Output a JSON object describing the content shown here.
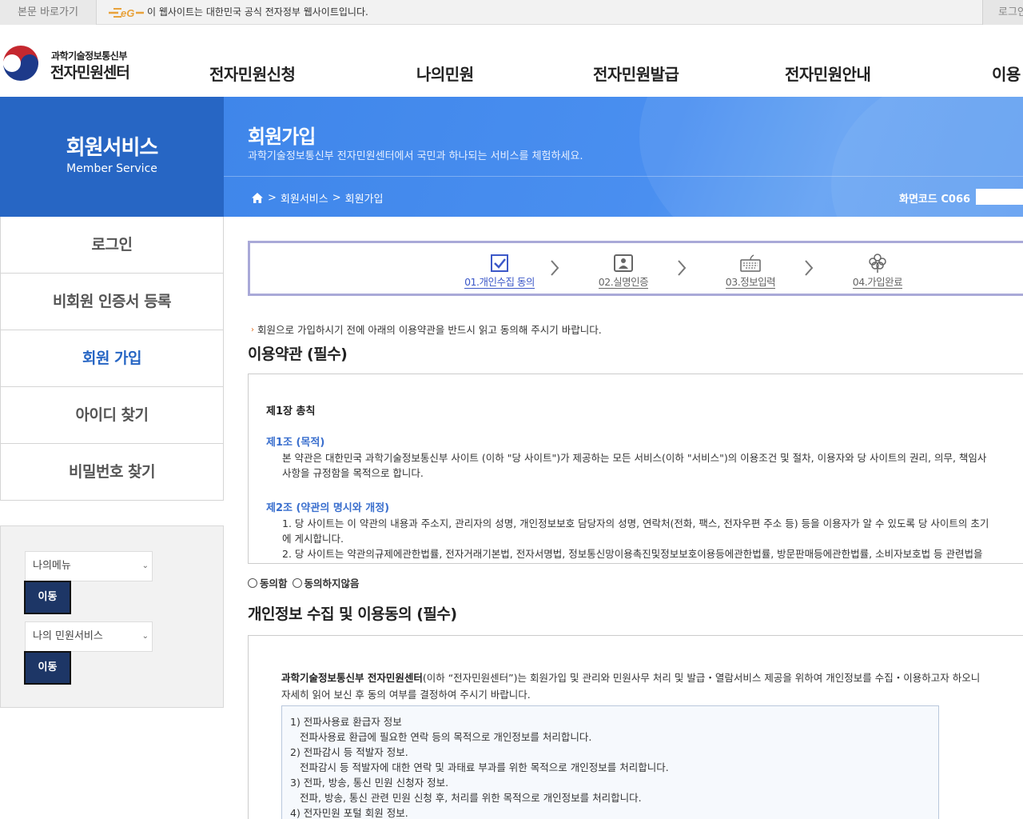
{
  "topbar": {
    "skip_label": "본문 바로가기",
    "gov_notice": "이 웹사이트는 대한민국 공식 전자정부 웹사이트입니다.",
    "login_label": "로그인"
  },
  "brand": {
    "ministry": "과학기술정보통신부",
    "center": "전자민원센터"
  },
  "gnb": [
    "전자민원신청",
    "나의민원",
    "전자민원발급",
    "전자민원안내",
    "이용"
  ],
  "lnb": {
    "title": "회원서비스",
    "subtitle": "Member Service"
  },
  "visual": {
    "title": "회원가입",
    "desc": "과학기술정보통신부 전자민원센터에서 국민과 하나되는 서비스를 체험하세요.",
    "breadcrumb": [
      "회원서비스",
      "회원가입"
    ],
    "breadcrumb_sep": ">",
    "screen_code": "화면코드 C066"
  },
  "side_menu": [
    "로그인",
    "비회원 인증서 등록",
    "회원 가입",
    "아이디 찾기",
    "비밀번호 찾기"
  ],
  "quick": {
    "select1": "나의메뉴",
    "select2": "나의 민원서비스",
    "go_label": "이동"
  },
  "steps": [
    "01.개인수집 동의",
    "02.실명인증",
    "03.정보입력",
    "04.가입완료"
  ],
  "notice": "회원으로 가입하시기 전에 아래의 이용약관을 반드시 읽고 동의해 주시기 바랍니다.",
  "terms": {
    "heading": "이용약관 (필수)",
    "chapter": "제1장 총칙",
    "art1_title": "제1조 (목적)",
    "art1_l1": "본 약관은 대한민국 과학기술정보통신부 사이트 (이하 \"당 사이트\")가 제공하는 모든 서비스(이하 \"서비스\")의 이용조건 및 절차, 이용자와 당 사이트의 권리, 의무, 책임사",
    "art1_l2": "사항을 규정함을 목적으로 합니다.",
    "art2_title": "제2조 (약관의 명시와 개정)",
    "art2_l1": "1. 당 사이트는 이 약관의 내용과 주소지, 관리자의 성명, 개인정보보호 담당자의 성명, 연락처(전화, 팩스, 전자우편 주소 등) 등을 이용자가 알 수 있도록 당 사이트의 초기",
    "art2_l2": "에 게시합니다.",
    "art2_l3": "2. 당 사이트는 약관의규제에관한법률, 전자거래기본법, 전자서명법, 정보통신망이용촉진및정보보호이용등에관한법률, 방문판매등에관한법률, 소비자보호법 등 관련법을",
    "agree": "동의함",
    "disagree": "동의하지않음"
  },
  "privacy": {
    "heading": "개인정보 수집 및 이용동의 (필수)",
    "intro_bold": "과학기술정보통신부 전자민원센터",
    "intro_rest": "(이하 “전자민원센터”)는 회원가입 및 관리와 민원사무 처리 및 발급・열람서비스 제공을 위하여 개인정보를 수집・이용하고자 하오니",
    "intro_l2": "자세히 읽어 보신 후 동의 여부를 결정하여 주시기 바랍니다.",
    "items": [
      "1) 전파사용료 환급자 정보",
      "전파사용료 환급에 필요한 연락 등의 목적으로 개인정보를 처리합니다.",
      "2) 전파감시 등 적발자 정보.",
      "전파감시 등 적발자에 대한 연락 및 과태료 부과를 위한 목적으로 개인정보를 처리합니다.",
      "3) 전파, 방송, 통신 민원 신청자 정보.",
      "전파, 방송, 통신 관련 민원 신청 후, 처리를 위한 목적으로 개인정보를 처리합니다.",
      "4) 전자민원 포털 회원 정보."
    ]
  },
  "colors": {
    "primary": "#2766c4",
    "visual": "#4a8ff0",
    "dark_button": "#1d3666",
    "accent_link": "#3a6fce"
  }
}
